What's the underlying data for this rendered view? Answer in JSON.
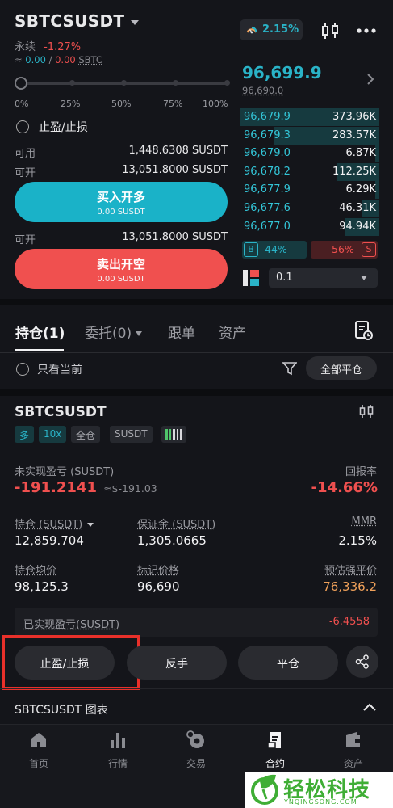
{
  "header": {
    "symbol": "SBTCSUSDT",
    "contract_type": "永续",
    "change": "-1.27%",
    "approx_prefix": "≈",
    "pnl_a": "0.00",
    "pnl_sep": "/",
    "pnl_b": "0.00",
    "pnl_unit": "SBTC",
    "funding_rate": "2.15%"
  },
  "leverage_slider": {
    "labels": [
      "0%",
      "25%",
      "50%",
      "75%",
      "100%"
    ],
    "value_fraction": 0
  },
  "order": {
    "tpsl_label": "止盈/止损",
    "available_label": "可用",
    "available_value": "1,448.6308 SUSDT",
    "can_open_label": "可开",
    "can_open_long_value": "13,051.8000 SUSDT",
    "buy_label": "买入开多",
    "buy_sub": "0.00 SUSDT",
    "can_open_short_label": "可开",
    "can_open_short_value": "13,051.8000 SUSDT",
    "sell_label": "卖出开空",
    "sell_sub": "0.00 SUSDT"
  },
  "orderbook": {
    "last_price": "96,699.9",
    "mark_price": "96,690.0",
    "rows": [
      {
        "price": "96,679.9",
        "qty": "373.96K",
        "depth": 1.0
      },
      {
        "price": "96,679.3",
        "qty": "283.57K",
        "depth": 0.76
      },
      {
        "price": "96,679.0",
        "qty": "6.87K",
        "depth": 0.03
      },
      {
        "price": "96,678.2",
        "qty": "112.25K",
        "depth": 0.3
      },
      {
        "price": "96,677.9",
        "qty": "6.29K",
        "depth": 0.03
      },
      {
        "price": "96,677.6",
        "qty": "46.31K",
        "depth": 0.13
      },
      {
        "price": "96,677.0",
        "qty": "94.94K",
        "depth": 0.25
      }
    ],
    "buy_badge": "B",
    "buy_ratio": "44%",
    "sell_ratio": "56%",
    "sell_badge": "S",
    "precision": "0.1"
  },
  "tabs": {
    "positions": "持仓(1)",
    "orders": "委托(0)",
    "copy": "跟单",
    "assets": "资产"
  },
  "filter": {
    "only_current": "只看当前",
    "close_all": "全部平仓"
  },
  "position": {
    "symbol": "SBTCSUSDT",
    "tags": [
      "多",
      "10x",
      "全仓",
      "SUSDT"
    ],
    "upnl_label": "未实现盈亏 (SUSDT)",
    "upnl_value": "-191.2141",
    "upnl_approx": "≈$-191.03",
    "roe_label": "回报率",
    "roe_value": "-14.66%",
    "size_label": "持仓 (SUSDT)",
    "size_value": "12,859.704",
    "margin_label": "保证金 (SUSDT)",
    "margin_value": "1,305.0665",
    "mmr_label": "MMR",
    "mmr_value": "2.15%",
    "entry_label": "持仓均价",
    "entry_value": "98,125.3",
    "mark_label": "标记价格",
    "mark_value": "96,690",
    "liq_label": "预估强平价",
    "liq_value": "76,336.2",
    "rpnl_label": "已实现盈亏(SUSDT)",
    "rpnl_value": "-6.4558"
  },
  "actions": {
    "tpsl": "止盈/止损",
    "reverse": "反手",
    "close": "平仓"
  },
  "chart_section": {
    "title": "SBTCSUSDT 图表"
  },
  "nav": {
    "items": [
      "首页",
      "行情",
      "交易",
      "合约",
      "资产"
    ],
    "active_index": 3
  },
  "watermark": {
    "text": "轻松科技",
    "sub": "YNQINGSONG.COM"
  },
  "colors": {
    "accent": "#2ab3c7",
    "buy": "#1ab2c8",
    "sell": "#f0504f",
    "highlight_box": "#e8302a",
    "liq_price": "#f0a15a"
  }
}
